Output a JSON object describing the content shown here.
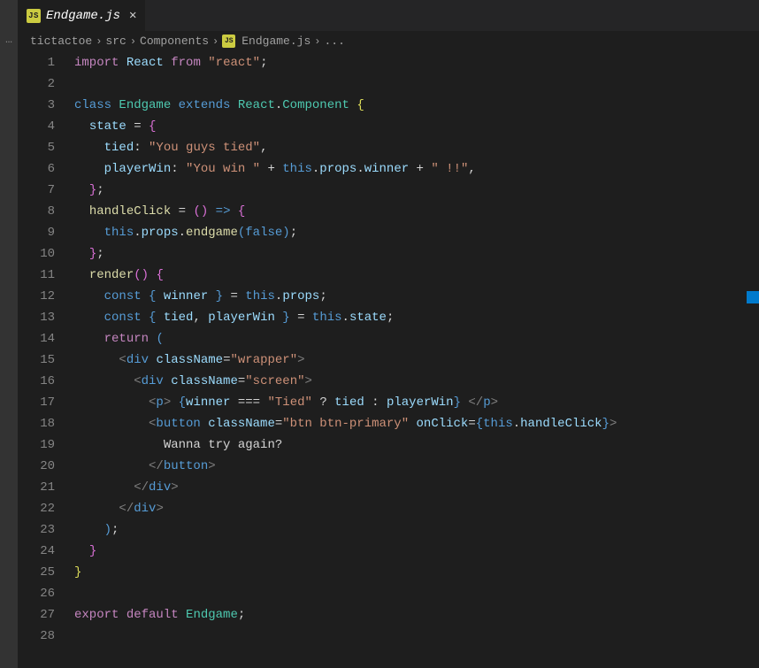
{
  "tab": {
    "icon_label": "JS",
    "filename": "Endgame.js"
  },
  "breadcrumbs": {
    "parts": [
      "tictactoe",
      "src",
      "Components"
    ],
    "file_icon": "JS",
    "filename": "Endgame.js",
    "tail": "..."
  },
  "gutter_start": 1,
  "gutter_end": 28,
  "code": {
    "l1": {
      "import": "import",
      "react_id": "React",
      "from": "from",
      "react_str": "\"react\""
    },
    "l3": {
      "class": "class",
      "name": "Endgame",
      "extends": "extends",
      "base1": "React",
      "dot": ".",
      "base2": "Component"
    },
    "l4": {
      "state": "state",
      "eq": "="
    },
    "l5": {
      "key": "tied",
      "val": "\"You guys tied\""
    },
    "l6": {
      "key": "playerWin",
      "val1": "\"You win \"",
      "plus": "+",
      "this": "this",
      "props": "props",
      "winner": "winner",
      "val2": "\" !!\""
    },
    "l8": {
      "name": "handleClick",
      "eq": "=",
      "arrow": "=>"
    },
    "l9": {
      "this": "this",
      "props": "props",
      "endgame": "endgame",
      "false": "false"
    },
    "l11": {
      "render": "render"
    },
    "l12": {
      "const": "const",
      "winner": "winner",
      "eq": "=",
      "this": "this",
      "props": "props"
    },
    "l13": {
      "const": "const",
      "tied": "tied",
      "playerWin": "playerWin",
      "eq": "=",
      "this": "this",
      "state": "state"
    },
    "l14": {
      "return": "return"
    },
    "l15": {
      "div": "div",
      "attr": "className",
      "val": "\"wrapper\""
    },
    "l16": {
      "div": "div",
      "attr": "className",
      "val": "\"screen\""
    },
    "l17": {
      "p": "p",
      "winner": "winner",
      "op": "===",
      "tied_str": "\"Tied\"",
      "q": "?",
      "tied": "tied",
      "colon": ":",
      "playerWin": "playerWin"
    },
    "l18": {
      "button": "button",
      "attr1": "className",
      "val1": "\"btn btn-primary\"",
      "attr2": "onClick",
      "this": "this",
      "handleClick": "handleClick"
    },
    "l19": {
      "text": "Wanna try again?"
    },
    "l20": {
      "button": "button"
    },
    "l21": {
      "div": "div"
    },
    "l22": {
      "div": "div"
    },
    "l27": {
      "export": "export",
      "default": "default",
      "name": "Endgame"
    }
  }
}
